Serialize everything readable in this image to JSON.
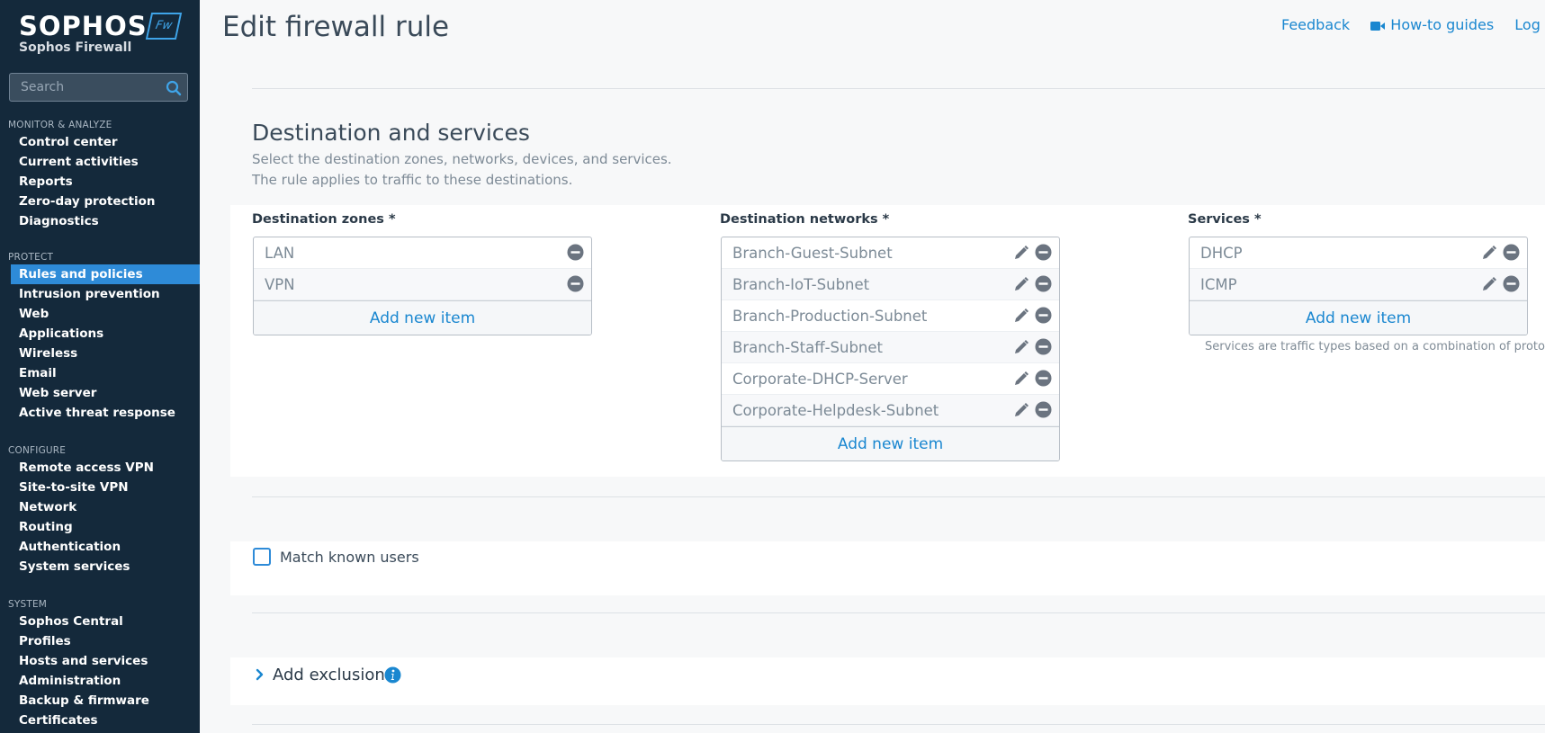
{
  "brand": {
    "name": "SOPHOS",
    "product": "Sophos Firewall",
    "badge": "Fw"
  },
  "search": {
    "placeholder": "Search"
  },
  "nav": [
    {
      "heading": "MONITOR & ANALYZE",
      "items": [
        "Control center",
        "Current activities",
        "Reports",
        "Zero-day protection",
        "Diagnostics"
      ]
    },
    {
      "heading": "PROTECT",
      "items": [
        "Rules and policies",
        "Intrusion prevention",
        "Web",
        "Applications",
        "Wireless",
        "Email",
        "Web server",
        "Active threat response"
      ]
    },
    {
      "heading": "CONFIGURE",
      "items": [
        "Remote access VPN",
        "Site-to-site VPN",
        "Network",
        "Routing",
        "Authentication",
        "System services"
      ]
    },
    {
      "heading": "SYSTEM",
      "items": [
        "Sophos Central",
        "Profiles",
        "Hosts and services",
        "Administration",
        "Backup & firmware",
        "Certificates"
      ]
    }
  ],
  "active_nav": "Rules and policies",
  "header": {
    "title": "Edit firewall rule",
    "links": {
      "feedback": "Feedback",
      "howto": "How-to guides",
      "log": "Log vie"
    }
  },
  "dest": {
    "title": "Destination and services",
    "desc1": "Select the destination zones, networks, devices, and services.",
    "desc2": "The rule applies to traffic to these destinations.",
    "zones": {
      "label": "Destination zones *",
      "items": [
        "LAN",
        "VPN"
      ],
      "add": "Add new item"
    },
    "networks": {
      "label": "Destination networks *",
      "items": [
        "Branch-Guest-Subnet",
        "Branch-IoT-Subnet",
        "Branch-Production-Subnet",
        "Branch-Staff-Subnet",
        "Corporate-DHCP-Server",
        "Corporate-Helpdesk-Subnet"
      ],
      "add": "Add new item"
    },
    "services": {
      "label": "Services *",
      "items": [
        "DHCP",
        "ICMP"
      ],
      "add": "Add new item",
      "note": "Services are traffic types based on a combination of protocol"
    }
  },
  "match_users": {
    "label": "Match known users",
    "checked": false
  },
  "exclusion": {
    "label": "Add exclusion"
  },
  "colors": {
    "sidebar": "#14293b",
    "accent": "#2e8bd8",
    "link": "#1a87d0"
  }
}
